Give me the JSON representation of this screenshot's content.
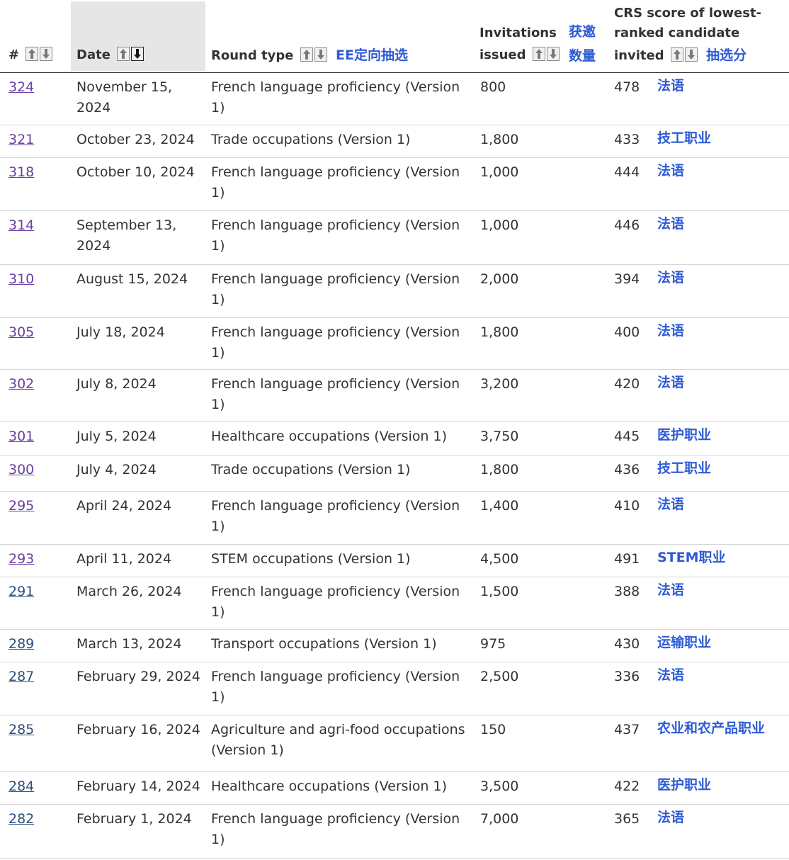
{
  "header": {
    "num": "#",
    "date": "Date",
    "round_type": "Round type",
    "round_type_note": "EE定向抽选",
    "invitations_line1": "Invitations",
    "invitations_line2": "issued",
    "invitations_note1": "获邀",
    "invitations_note2": "数量",
    "crs_line1": "CRS score of lowest-",
    "crs_line2": "ranked candidate",
    "crs_line3": "invited",
    "crs_note": "抽选分"
  },
  "rows": [
    {
      "num": "324",
      "date": "November 15, 2024",
      "round": "French language proficiency (Version 1)",
      "inv": "800",
      "crs": "478",
      "tag": "法语",
      "visited": true
    },
    {
      "num": "321",
      "date": "October 23, 2024",
      "round": "Trade occupations (Version 1)",
      "inv": "1,800",
      "crs": "433",
      "tag": "技工职业",
      "visited": true
    },
    {
      "num": "318",
      "date": "October 10, 2024",
      "round": "French language proficiency (Version 1)",
      "inv": "1,000",
      "crs": "444",
      "tag": "法语",
      "visited": true
    },
    {
      "num": "314",
      "date": "September 13, 2024",
      "round": "French language proficiency (Version 1)",
      "inv": "1,000",
      "crs": "446",
      "tag": "法语",
      "visited": true
    },
    {
      "num": "310",
      "date": "August 15, 2024",
      "round": "French language proficiency (Version 1)",
      "inv": "2,000",
      "crs": "394",
      "tag": "法语",
      "visited": true
    },
    {
      "num": "305",
      "date": "July 18, 2024",
      "round": "French language proficiency (Version 1)",
      "inv": "1,800",
      "crs": "400",
      "tag": "法语",
      "visited": true
    },
    {
      "num": "302",
      "date": "July 8, 2024",
      "round": "French language proficiency (Version 1)",
      "inv": "3,200",
      "crs": "420",
      "tag": "法语",
      "visited": true
    },
    {
      "num": "301",
      "date": "July 5, 2024",
      "round": "Healthcare occupations (Version 1)",
      "inv": "3,750",
      "crs": "445",
      "tag": "医护职业",
      "visited": true
    },
    {
      "num": "300",
      "date": "July 4, 2024",
      "round": "Trade occupations (Version 1)",
      "inv": "1,800",
      "crs": "436",
      "tag": "技工职业",
      "visited": true
    },
    {
      "num": "295",
      "date": "April 24, 2024",
      "round": "French language proficiency (Version 1)",
      "inv": "1,400",
      "crs": "410",
      "tag": "法语",
      "visited": true
    },
    {
      "num": "293",
      "date": "April 11, 2024",
      "round": "STEM occupations (Version 1)",
      "inv": "4,500",
      "crs": "491",
      "tag": "STEM职业",
      "visited": true
    },
    {
      "num": "291",
      "date": "March 26, 2024",
      "round": "French language proficiency (Version 1)",
      "inv": "1,500",
      "crs": "388",
      "tag": "法语",
      "visited": false
    },
    {
      "num": "289",
      "date": "March 13, 2024",
      "round": "Transport occupations (Version 1)",
      "inv": "975",
      "crs": "430",
      "tag": "运输职业",
      "visited": false
    },
    {
      "num": "287",
      "date": "February 29, 2024",
      "round": "French language proficiency (Version 1)",
      "inv": "2,500",
      "crs": "336",
      "tag": "法语",
      "visited": false
    },
    {
      "num": "285",
      "date": "February 16, 2024",
      "round": "Agriculture and agri-food occupations (Version 1)",
      "inv": "150",
      "crs": "437",
      "tag": "农业和农产品职业",
      "visited": false
    },
    {
      "num": "284",
      "date": "February 14, 2024",
      "round": "Healthcare occupations (Version 1)",
      "inv": "3,500",
      "crs": "422",
      "tag": "医护职业",
      "visited": false
    },
    {
      "num": "282",
      "date": "February 1, 2024",
      "round": "French language proficiency (Version 1)",
      "inv": "7,000",
      "crs": "365",
      "tag": "法语",
      "visited": false
    }
  ]
}
